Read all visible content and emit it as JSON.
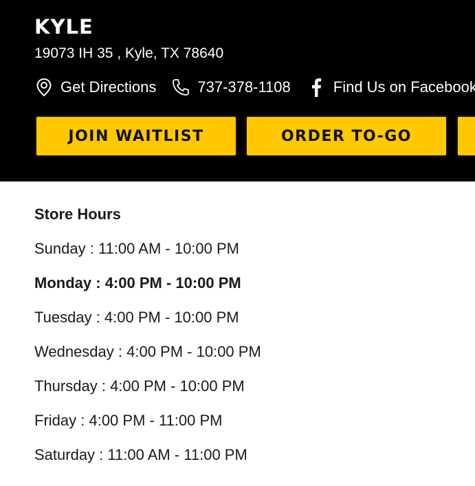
{
  "store": {
    "name": "KYLE",
    "address": "19073 IH 35 , Kyle, TX 78640"
  },
  "contact": {
    "directions_label": "Get Directions",
    "phone": "737-378-1108",
    "facebook_label": "Find Us on Facebook"
  },
  "buttons": {
    "waitlist": "JOIN WAITLIST",
    "togo": "ORDER TO-GO"
  },
  "colors": {
    "header_bg": "#000000",
    "button_bg": "#ffc800",
    "text_dark": "#1a1a1a"
  },
  "hours": {
    "title": "Store Hours",
    "days": [
      {
        "day": "Sunday",
        "time": "11:00 AM - 10:00 PM"
      },
      {
        "day": "Monday",
        "time": "4:00 PM - 10:00 PM",
        "today": true
      },
      {
        "day": "Tuesday",
        "time": "4:00 PM - 10:00 PM"
      },
      {
        "day": "Wednesday",
        "time": "4:00 PM - 10:00 PM"
      },
      {
        "day": "Thursday",
        "time": "4:00 PM - 10:00 PM"
      },
      {
        "day": "Friday",
        "time": "4:00 PM - 11:00 PM"
      },
      {
        "day": "Saturday",
        "time": "11:00 AM - 11:00 PM"
      }
    ]
  }
}
